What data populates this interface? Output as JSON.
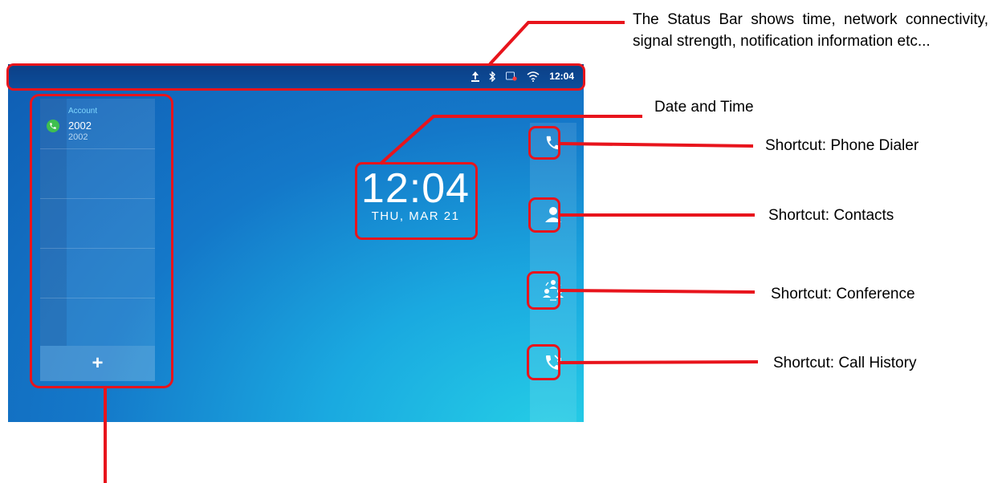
{
  "status_bar": {
    "time": "12:04",
    "icons": [
      "upload-icon",
      "bluetooth-icon",
      "phone-record-icon",
      "wifi-icon"
    ]
  },
  "accounts": {
    "label": "Account",
    "name": "2002",
    "number": "2002",
    "add_label": "+"
  },
  "clock": {
    "time": "12:04",
    "date": "THU, MAR 21"
  },
  "shortcuts": [
    {
      "icon": "phone-icon"
    },
    {
      "icon": "contact-icon"
    },
    {
      "icon": "conference-icon"
    },
    {
      "icon": "call-history-icon"
    }
  ],
  "annotations": {
    "status_bar": "The Status Bar shows time, network connectivity, signal strength, notification information etc...",
    "date_time": "Date and Time",
    "phone_dialer": "Shortcut: Phone Dialer",
    "contacts": "Shortcut: Contacts",
    "conference": "Shortcut: Conference",
    "call_history": "Shortcut: Call History"
  },
  "colors": {
    "highlight": "#e8141c",
    "status_bar": "#0b3f86",
    "screen_top": "#0f5db3",
    "screen_bottom": "#25cfe6",
    "account_green": "#3fbf4f",
    "account_label": "#7fd7ff"
  }
}
